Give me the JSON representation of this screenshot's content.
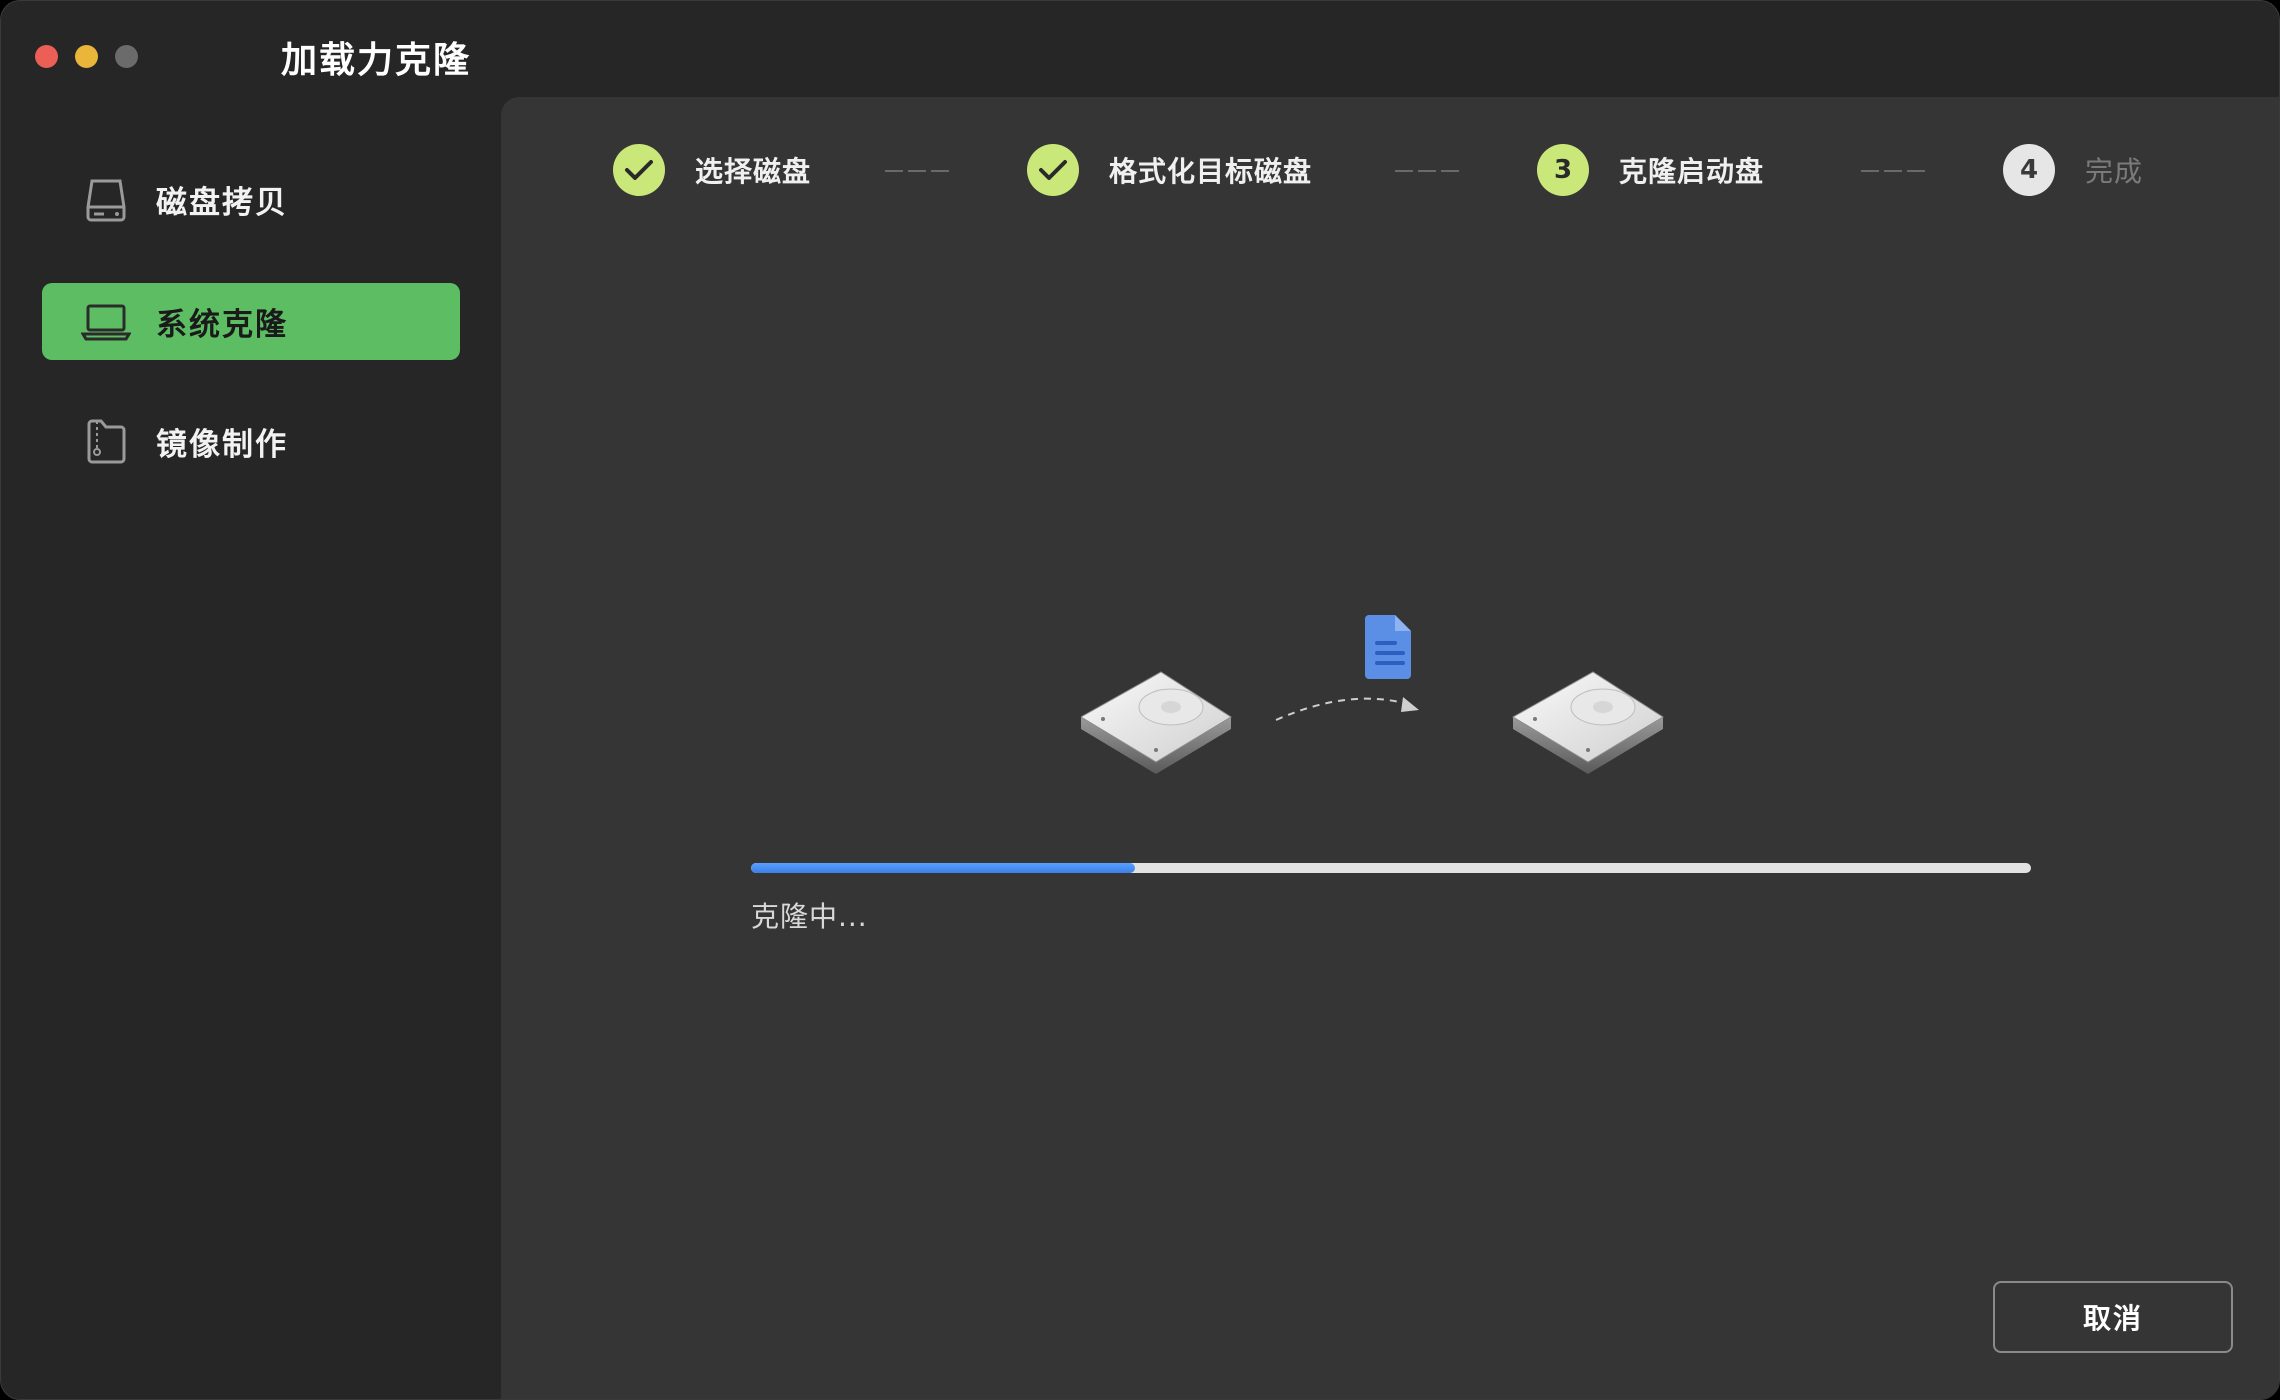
{
  "app": {
    "title": "加载力克隆"
  },
  "sidebar": {
    "items": [
      {
        "label": "磁盘拷贝",
        "icon": "drive-icon",
        "active": false
      },
      {
        "label": "系统克隆",
        "icon": "laptop-icon",
        "active": true
      },
      {
        "label": "镜像制作",
        "icon": "disk-image-icon",
        "active": false
      }
    ]
  },
  "steps": [
    {
      "label": "选择磁盘",
      "state": "done"
    },
    {
      "label": "格式化目标磁盘",
      "state": "done"
    },
    {
      "number": "3",
      "label": "克隆启动盘",
      "state": "current"
    },
    {
      "number": "4",
      "label": "完成",
      "state": "todo"
    }
  ],
  "progress": {
    "fraction": 0.3,
    "status": "克隆中..."
  },
  "actions": {
    "cancel_label": "取消"
  },
  "colors": {
    "accent_green": "#5cbd63",
    "step_green": "#c9e879",
    "progress_blue": "#3a7fe8"
  }
}
